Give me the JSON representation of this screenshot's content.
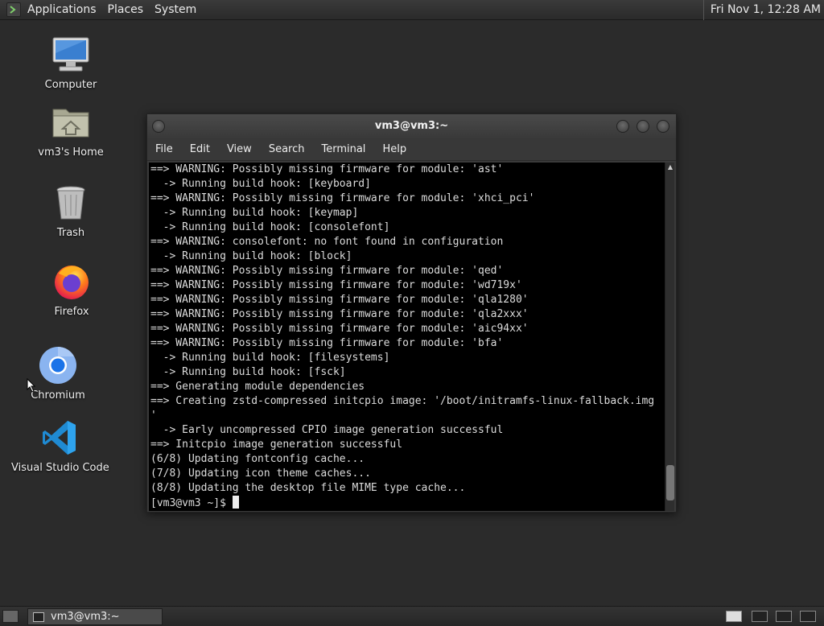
{
  "top_panel": {
    "menus": [
      "Applications",
      "Places",
      "System"
    ],
    "clock": "Fri Nov 1, 12:28 AM"
  },
  "desktop_icons": [
    {
      "label": "Computer",
      "icon": "computer-icon"
    },
    {
      "label": "vm3's Home",
      "icon": "home-folder-icon"
    },
    {
      "label": "Trash",
      "icon": "trash-icon"
    },
    {
      "label": "Firefox",
      "icon": "firefox-icon"
    },
    {
      "label": "Chromium",
      "icon": "chromium-icon"
    },
    {
      "label": "Visual Studio Code",
      "icon": "vscode-icon"
    }
  ],
  "window": {
    "title": "vm3@vm3:~",
    "menus": [
      "File",
      "Edit",
      "View",
      "Search",
      "Terminal",
      "Help"
    ],
    "terminal_lines": [
      "==> WARNING: Possibly missing firmware for module: 'ast'",
      "  -> Running build hook: [keyboard]",
      "==> WARNING: Possibly missing firmware for module: 'xhci_pci'",
      "  -> Running build hook: [keymap]",
      "  -> Running build hook: [consolefont]",
      "==> WARNING: consolefont: no font found in configuration",
      "  -> Running build hook: [block]",
      "==> WARNING: Possibly missing firmware for module: 'qed'",
      "==> WARNING: Possibly missing firmware for module: 'wd719x'",
      "==> WARNING: Possibly missing firmware for module: 'qla1280'",
      "==> WARNING: Possibly missing firmware for module: 'qla2xxx'",
      "==> WARNING: Possibly missing firmware for module: 'aic94xx'",
      "==> WARNING: Possibly missing firmware for module: 'bfa'",
      "  -> Running build hook: [filesystems]",
      "  -> Running build hook: [fsck]",
      "==> Generating module dependencies",
      "==> Creating zstd-compressed initcpio image: '/boot/initramfs-linux-fallback.img",
      "'",
      "  -> Early uncompressed CPIO image generation successful",
      "==> Initcpio image generation successful",
      "(6/8) Updating fontconfig cache...",
      "(7/8) Updating icon theme caches...",
      "(8/8) Updating the desktop file MIME type cache..."
    ],
    "prompt": "[vm3@vm3 ~]$ "
  },
  "bottom_panel": {
    "task_label": "vm3@vm3:~"
  }
}
